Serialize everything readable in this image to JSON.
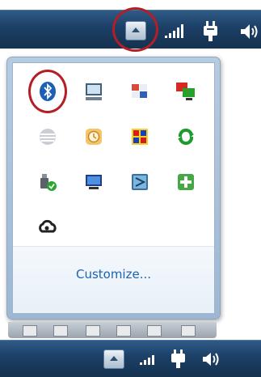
{
  "taskbar": {
    "show_hidden_icons": "show-hidden-icons-button",
    "icons": [
      "network-signal-icon",
      "power-plug-icon",
      "volume-icon"
    ]
  },
  "tray_overflow": {
    "customize_label": "Customize...",
    "icons": [
      [
        "bluetooth-icon",
        "computer-monitor-icon",
        "shield-flag-icon",
        "remote-display-icon"
      ],
      [
        "att-globe-icon",
        "clock-update-icon",
        "colorful-app-icon",
        "green-sync-icon"
      ],
      [
        "usb-safe-remove-icon",
        "presentation-display-icon",
        "teal-app-icon",
        "green-plus-icon"
      ],
      [
        "creative-cloud-icon"
      ]
    ]
  },
  "colors": {
    "taskbar": "#1c3f66",
    "highlight_ring": "#b41e24",
    "link": "#1a63b5"
  }
}
